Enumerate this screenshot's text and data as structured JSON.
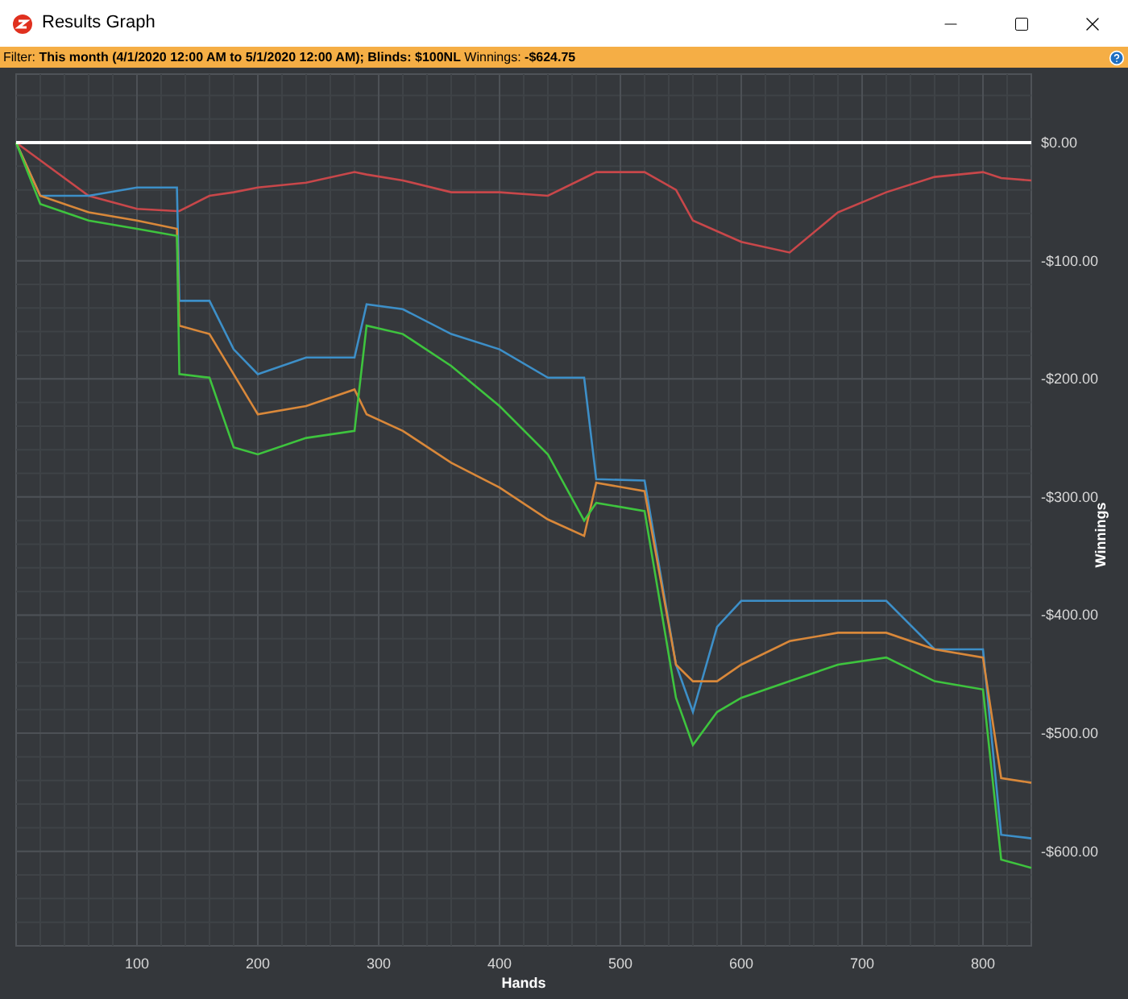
{
  "window": {
    "title": "Results Graph"
  },
  "filter_bar": {
    "text": "Filter: **This month (4/1/2020 12:00 AM to 5/1/2020 12:00 AM); Blinds: $100NL** Winnings: **-$624.75**"
  },
  "chart": {
    "chart_data": {
      "type": "line",
      "grid": true,
      "xlabel": "Hands",
      "ylabel": "Winnings",
      "xlim": [
        0,
        840
      ],
      "ylim": [
        -680,
        58
      ],
      "xticks": [
        100,
        200,
        300,
        400,
        500,
        600,
        700,
        800
      ],
      "yticks": [
        {
          "value": 0,
          "label": "$0.00"
        },
        {
          "value": -100,
          "label": "-$100.00"
        },
        {
          "value": -200,
          "label": "-$200.00"
        },
        {
          "value": -300,
          "label": "-$300.00"
        },
        {
          "value": -400,
          "label": "-$400.00"
        },
        {
          "value": -500,
          "label": "-$500.00"
        },
        {
          "value": -600,
          "label": "-$600.00"
        }
      ],
      "x": [
        0,
        20,
        60,
        100,
        133,
        135,
        160,
        180,
        200,
        240,
        280,
        290,
        320,
        360,
        400,
        440,
        470,
        480,
        520,
        546,
        560,
        580,
        600,
        640,
        680,
        720,
        760,
        800,
        815,
        840
      ],
      "series": [
        {
          "color": "#c8474a",
          "values": [
            0,
            -15,
            -45,
            -56,
            -58,
            -58,
            -45,
            -42,
            -38,
            -34,
            -25,
            -27,
            -32,
            -42,
            -42,
            -45,
            -30,
            -25,
            -25,
            -40,
            -66,
            -75,
            -84,
            -93,
            -59,
            -42,
            -29,
            -25,
            -30,
            -32
          ]
        },
        {
          "color": "#3d8fc8",
          "values": [
            0,
            -45,
            -45,
            -38,
            -38,
            -134,
            -134,
            -175,
            -196,
            -182,
            -182,
            -137,
            -141,
            -162,
            -175,
            -199,
            -199,
            -285,
            -286,
            -442,
            -482,
            -410,
            -388,
            -388,
            -388,
            -388,
            -429,
            -429,
            -586,
            -589
          ]
        },
        {
          "color": "#d9883a",
          "values": [
            0,
            -45,
            -59,
            -66,
            -73,
            -155,
            -162,
            -196,
            -230,
            -223,
            -209,
            -230,
            -244,
            -271,
            -292,
            -319,
            -333,
            -288,
            -295,
            -442,
            -456,
            -456,
            -442,
            -422,
            -415,
            -415,
            -429,
            -436,
            -538,
            -542
          ]
        },
        {
          "color": "#3ec43e",
          "values": [
            0,
            -52,
            -66,
            -73,
            -79,
            -196,
            -199,
            -258,
            -264,
            -250,
            -244,
            -155,
            -162,
            -189,
            -223,
            -264,
            -320,
            -305,
            -312,
            -470,
            -510,
            -482,
            -470,
            -456,
            -442,
            -436,
            -456,
            -463,
            -607,
            -614
          ]
        }
      ]
    }
  }
}
